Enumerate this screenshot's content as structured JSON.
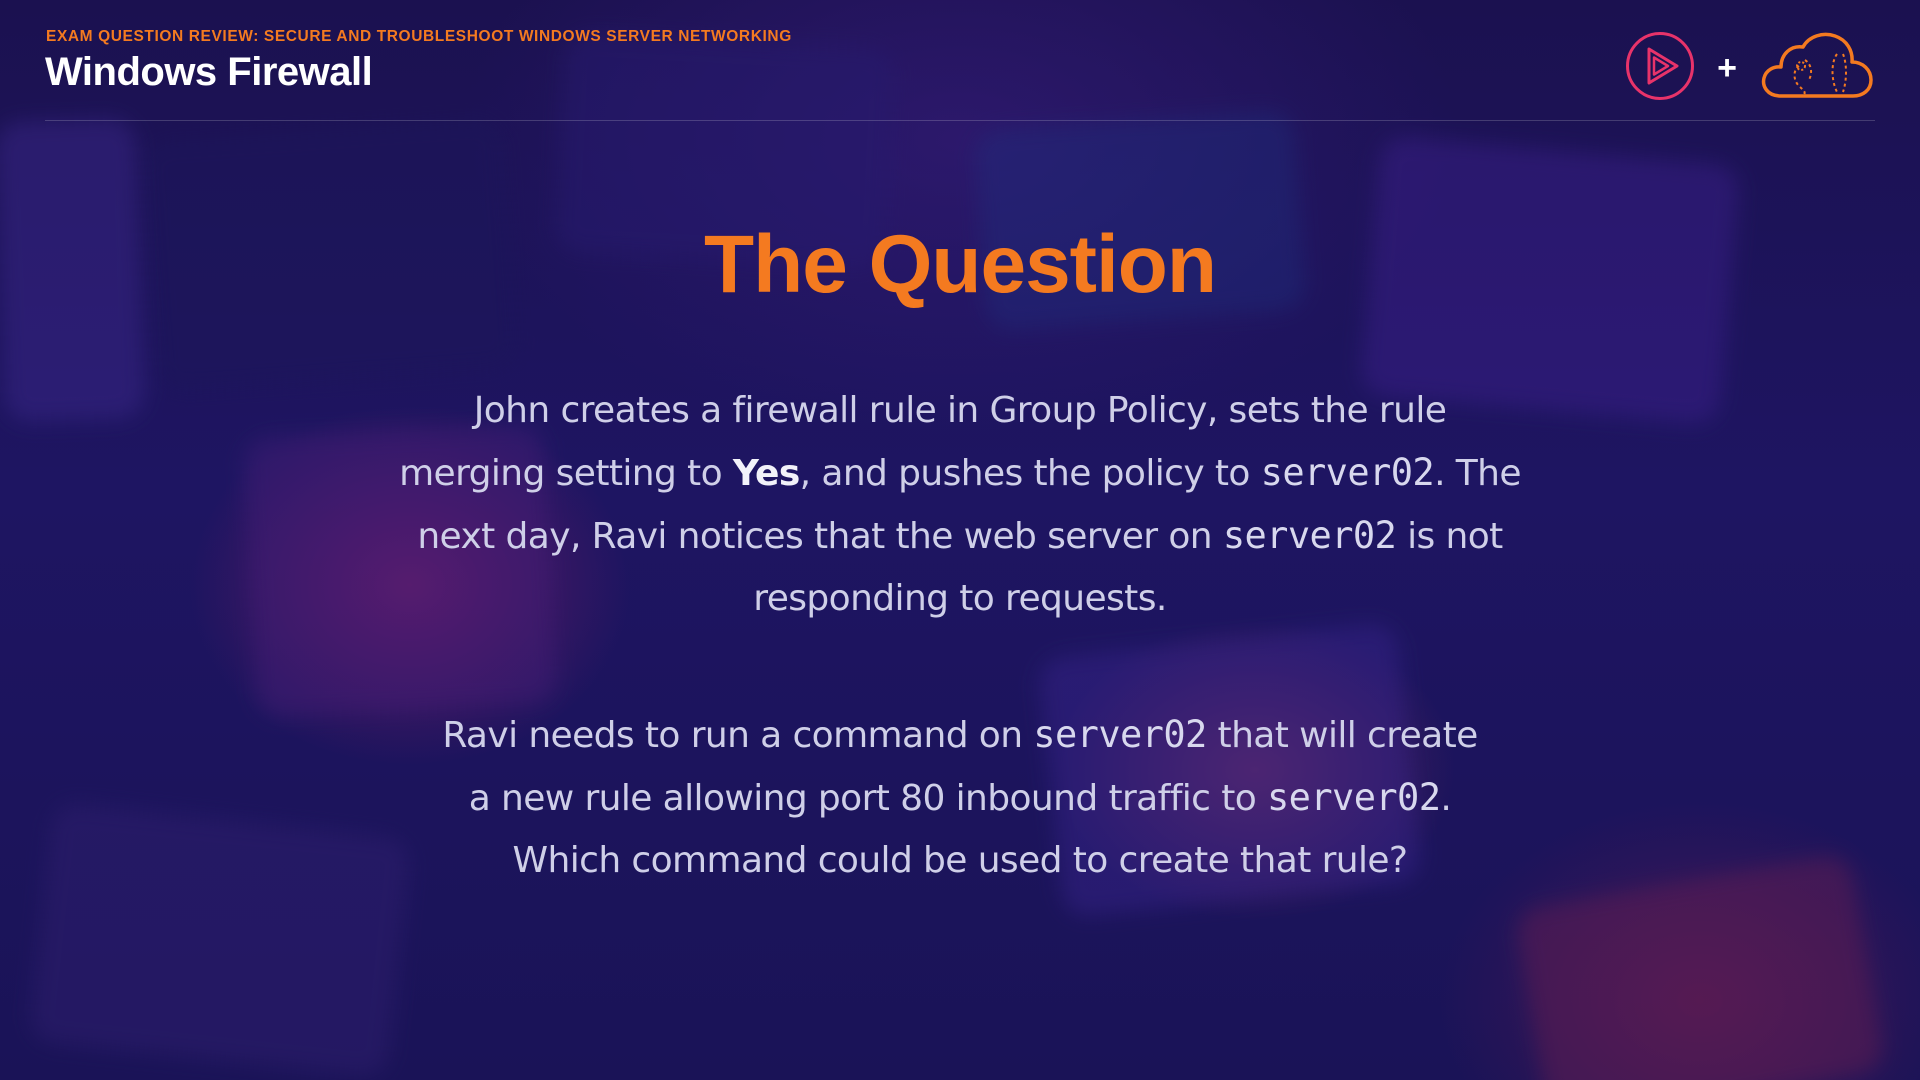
{
  "header": {
    "course_label": "EXAM QUESTION REVIEW: SECURE AND TROUBLESHOOT WINDOWS SERVER NETWORKING",
    "module_title": "Windows Firewall",
    "plus": "+",
    "accent_color": "#f47a20",
    "play_logo_color": "#e8336a",
    "icons": [
      "play-logo-icon",
      "cloud-logo-icon"
    ]
  },
  "slide": {
    "title": "The Question",
    "paragraph1": {
      "line1": "John creates a firewall rule in Group Policy, sets the rule",
      "line2_a": "merging setting to ",
      "line2_bold": "Yes",
      "line2_b": ", and pushes the policy to ",
      "line2_code": "server02",
      "line2_c": ". The",
      "line3_a": "next day, Ravi notices that the web server on ",
      "line3_code": "server02",
      "line3_b": " is not",
      "line4": "responding to requests."
    },
    "paragraph2": {
      "line1_a": "Ravi needs to run a command on ",
      "line1_code": "server02",
      "line1_b": " that will create",
      "line2_a": "a new rule allowing port 80 inbound traffic to ",
      "line2_code": "server02",
      "line2_b": ".",
      "line3": "Which command could be used to create that rule?"
    }
  }
}
